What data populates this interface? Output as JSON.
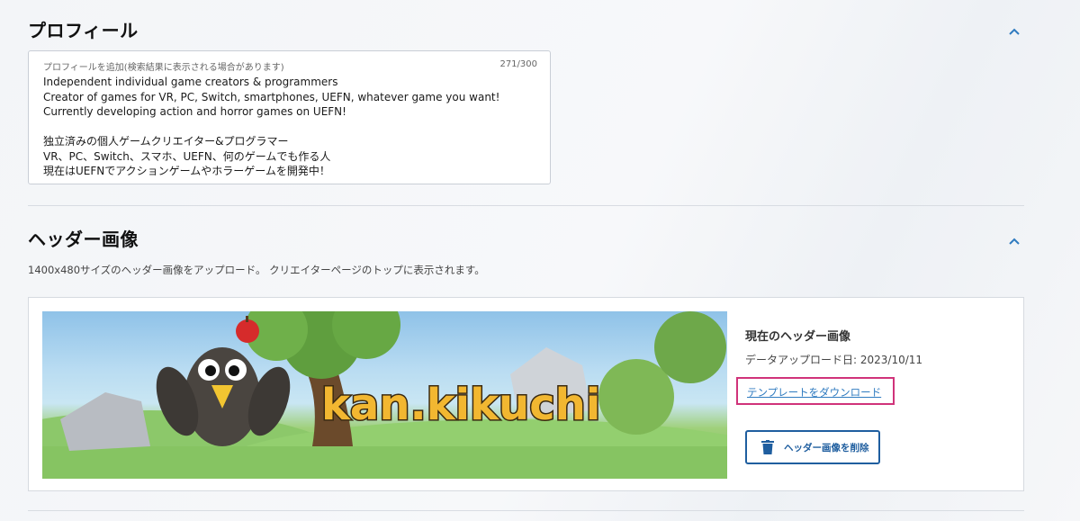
{
  "profile": {
    "title": "プロフィール",
    "field_label": "プロフィールを追加(検索結果に表示される場合があります)",
    "char_count": "271/300",
    "text": "Independent individual game creators & programmers\nCreator of games for VR, PC, Switch, smartphones, UEFN, whatever game you want!\nCurrently developing action and horror games on UEFN!\n\n独立済みの個人ゲームクリエイター&プログラマー\nVR、PC、Switch、スマホ、UEFN、何のゲームでも作る人\n現在はUEFNでアクションゲームやホラーゲームを開発中！"
  },
  "header_image": {
    "title": "ヘッダー画像",
    "description": "1400x480サイズのヘッダー画像をアップロード。 クリエイターページのトップに表示されます。",
    "banner_logo_text": "kan.kikuchi",
    "current_label": "現在のヘッダー画像",
    "upload_date": "データアップロード日: 2023/10/11",
    "template_link": "テンプレートをダウンロード",
    "delete_button": "ヘッダー画像を削除"
  },
  "colors": {
    "accent": "#1f5e9f",
    "link": "#2f7bc0",
    "highlight_border": "#d0337a"
  },
  "icons": {
    "collapse": "chevron-up-icon",
    "delete": "trash-icon"
  }
}
